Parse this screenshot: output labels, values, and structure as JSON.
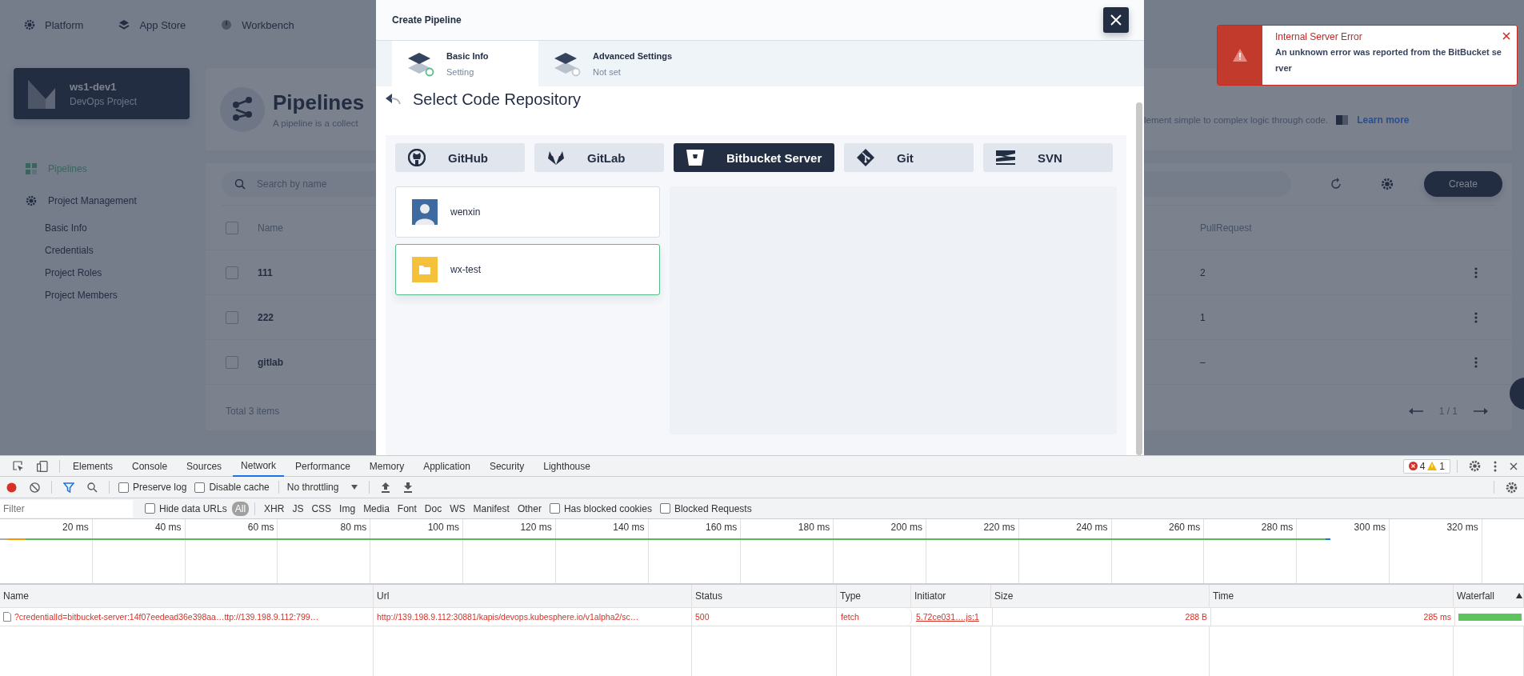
{
  "top_nav": [
    {
      "label": "Platform",
      "kind": "gear"
    },
    {
      "label": "App Store",
      "kind": "layers"
    },
    {
      "label": "Workbench",
      "kind": "dial"
    }
  ],
  "project": {
    "name": "ws1-dev1",
    "type": "DevOps Project"
  },
  "sidebar": {
    "items": [
      {
        "label": "Pipelines",
        "kind": "pipelines",
        "selected": true
      },
      {
        "label": "Project Management",
        "kind": "gear",
        "selected": false,
        "children": [
          {
            "label": "Basic Info",
            "selected": false
          },
          {
            "label": "Credentials",
            "selected": false
          },
          {
            "label": "Project Roles",
            "selected": false
          },
          {
            "label": "Project Members",
            "selected": false
          }
        ]
      }
    ]
  },
  "page_header": {
    "title": "Pipelines",
    "description_left": "A pipeline is a collect",
    "description_right": "lement simple to complex logic through code.",
    "link": "Learn more"
  },
  "toolbar": {
    "search_placeholder": "Search by name",
    "create_button": "Create"
  },
  "table": {
    "columns": [
      "Name",
      "PullRequest"
    ],
    "all_checked": false,
    "rows": [
      {
        "name": "111",
        "pull_request": "2",
        "checked": false
      },
      {
        "name": "222",
        "pull_request": "1",
        "checked": false
      },
      {
        "name": "gitlab",
        "pull_request": "–",
        "checked": false
      }
    ],
    "footer": "Total 3 items",
    "pagination": "1 / 1"
  },
  "modal": {
    "title": "Create Pipeline",
    "steps": [
      {
        "title": "Basic Info",
        "status": "Setting",
        "selected": true
      },
      {
        "title": "Advanced Settings",
        "status": "Not set",
        "selected": false
      }
    ],
    "section_title": "Select Code Repository",
    "sources": [
      {
        "label": "GitHub",
        "kind": "github",
        "selected": false
      },
      {
        "label": "GitLab",
        "kind": "gitlab",
        "selected": false
      },
      {
        "label": "Bitbucket Server",
        "kind": "bitbucket",
        "selected": true
      },
      {
        "label": "Git",
        "kind": "git",
        "selected": false
      },
      {
        "label": "SVN",
        "kind": "svn",
        "selected": false
      }
    ],
    "repositories": [
      {
        "name": "wenxin",
        "kind": "user",
        "selected": false
      },
      {
        "name": "wx-test",
        "kind": "folder",
        "selected": true
      }
    ]
  },
  "notification": {
    "title": "Internal Server Error",
    "message": "An unknown error was reported from the BitBucket server"
  },
  "devtools": {
    "tabs": [
      {
        "label": "Elements",
        "selected": false
      },
      {
        "label": "Console",
        "selected": false
      },
      {
        "label": "Sources",
        "selected": false
      },
      {
        "label": "Network",
        "selected": true
      },
      {
        "label": "Performance",
        "selected": false
      },
      {
        "label": "Memory",
        "selected": false
      },
      {
        "label": "Application",
        "selected": false
      },
      {
        "label": "Security",
        "selected": false
      },
      {
        "label": "Lighthouse",
        "selected": false
      }
    ],
    "errors": "4",
    "warnings": "1",
    "options": [
      {
        "label": "Preserve log",
        "checked": false
      },
      {
        "label": "Disable cache",
        "checked": false
      }
    ],
    "throttling": "No throttling",
    "filter_placeholder": "Filter",
    "hide_data_urls": {
      "label": "Hide data URLs",
      "checked": false
    },
    "types": [
      {
        "label": "All",
        "selected": true
      },
      {
        "label": "XHR",
        "selected": false
      },
      {
        "label": "JS",
        "selected": false
      },
      {
        "label": "CSS",
        "selected": false
      },
      {
        "label": "Img",
        "selected": false
      },
      {
        "label": "Media",
        "selected": false
      },
      {
        "label": "Font",
        "selected": false
      },
      {
        "label": "Doc",
        "selected": false
      },
      {
        "label": "WS",
        "selected": false
      },
      {
        "label": "Manifest",
        "selected": false
      },
      {
        "label": "Other",
        "selected": false
      }
    ],
    "blocking": [
      {
        "label": "Has blocked cookies",
        "checked": false
      },
      {
        "label": "Blocked Requests",
        "checked": false
      }
    ],
    "timeline_ticks": [
      "20 ms",
      "40 ms",
      "60 ms",
      "80 ms",
      "100 ms",
      "120 ms",
      "140 ms",
      "160 ms",
      "180 ms",
      "200 ms",
      "220 ms",
      "240 ms",
      "260 ms",
      "280 ms",
      "300 ms",
      "320 ms"
    ],
    "columns": [
      "Name",
      "Url",
      "Status",
      "Type",
      "Initiator",
      "Size",
      "Time",
      "Waterfall"
    ],
    "requests": [
      {
        "name": "?credentialId=bitbucket-server:14f07eedead36e398aa…ttp://139.198.9.112:799…",
        "url": "http://139.198.9.112:30881/kapis/devops.kubesphere.io/v1alpha2/sc…",
        "status": "500",
        "type": "fetch",
        "initiator": "5.72ce031….js:1",
        "size": "288 B",
        "time": "285 ms",
        "failed": true
      }
    ]
  }
}
